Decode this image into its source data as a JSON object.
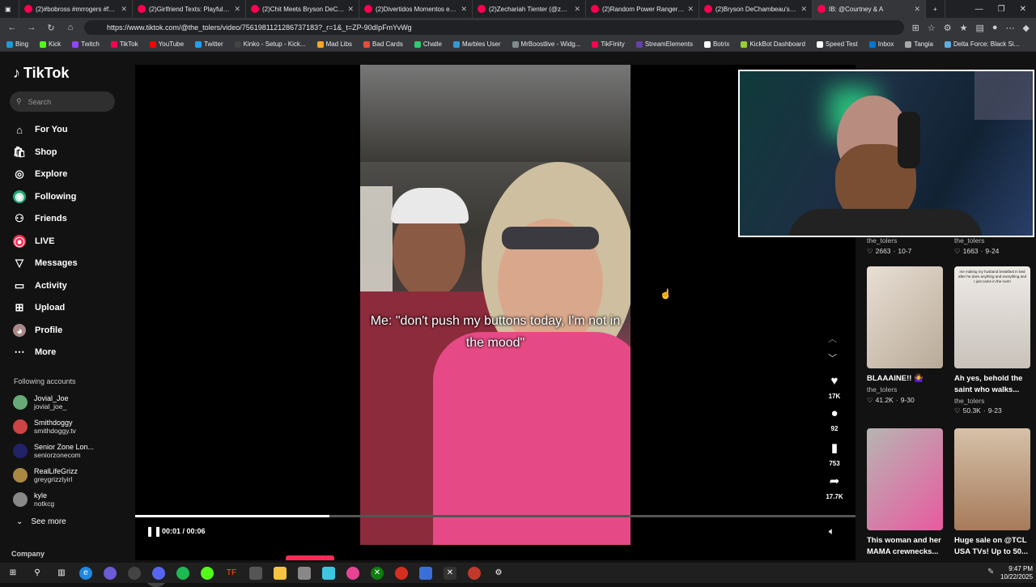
{
  "browser": {
    "tabs": [
      {
        "title": "(2)#bobross #mrrogers #faceb",
        "active": false
      },
      {
        "title": "(2)Girlfriend Texts: Playful Resp",
        "active": false
      },
      {
        "title": "(2)Chit Meets Bryson DeCham",
        "active": false
      },
      {
        "title": "(2)Divertidos Momentos en la",
        "active": false
      },
      {
        "title": "(2)Zechariah Tienter (@zechar",
        "active": false
      },
      {
        "title": "(2)Random Power Rangers Mo",
        "active": false
      },
      {
        "title": "(2)Bryson DeChambeau's Une",
        "active": false
      },
      {
        "title": "IB: @Courtney & A",
        "active": true
      }
    ],
    "url": "https://www.tiktok.com/@the_tolers/video/7561981121286737183?_r=1&_t=ZP-90dIpFmYvWg",
    "bookmarks": [
      "Bing",
      "Kick",
      "Twitch",
      "TikTok",
      "YouTube",
      "Twitter",
      "Kinko - Setup - Kick...",
      "Mad Libs",
      "Bad Cards",
      "Chatle",
      "Marbles User",
      "MrBoostlive - Widg...",
      "TikFinity",
      "StreamElements",
      "Botrix",
      "KickBot Dashboard",
      "Speed Test",
      "Inbox",
      "Tangia",
      "Delta Force: Black Si..."
    ]
  },
  "sidebar": {
    "logo": "TikTok",
    "search_placeholder": "Search",
    "nav": [
      {
        "label": "For You",
        "icon": "home-icon"
      },
      {
        "label": "Shop",
        "icon": "shop-icon"
      },
      {
        "label": "Explore",
        "icon": "compass-icon"
      },
      {
        "label": "Following",
        "icon": "following-icon"
      },
      {
        "label": "Friends",
        "icon": "friends-icon"
      },
      {
        "label": "LIVE",
        "icon": "live-icon"
      },
      {
        "label": "Messages",
        "icon": "messages-icon"
      },
      {
        "label": "Activity",
        "icon": "activity-icon"
      },
      {
        "label": "Upload",
        "icon": "upload-icon"
      },
      {
        "label": "Profile",
        "icon": "profile-icon"
      },
      {
        "label": "More",
        "icon": "more-icon"
      }
    ],
    "following_header": "Following accounts",
    "accounts": [
      {
        "name": "Jovial_Joe",
        "handle": "jovial_joe_"
      },
      {
        "name": "Smithdoggy",
        "handle": "smithdoggy.tv"
      },
      {
        "name": "Senior Zone Lon...",
        "handle": "seniorzonecom"
      },
      {
        "name": "RealLifeGrizz",
        "handle": "greygrizzlyirl"
      },
      {
        "name": "kyle",
        "handle": "notkcg"
      }
    ],
    "see_more": "See more",
    "company": "Company"
  },
  "player": {
    "caption": "Me: \"don't push my buttons today, I'm not in the mood\"",
    "time": "00:01 / 00:06",
    "progress": 0.27,
    "author": "the_tolers"
  },
  "actions": {
    "likes": "17K",
    "comments": "92",
    "saves": "753",
    "shares": "17.7K"
  },
  "grid": {
    "top_row": [
      {
        "user": "the_tolers",
        "likes": "2663",
        "date": "10-7"
      },
      {
        "user": "the_tolers",
        "likes": "1663",
        "date": "9-24"
      }
    ],
    "videos": [
      {
        "title": "BLAAAINE!! 🤷‍♀️",
        "user": "the_tolers",
        "likes": "41.2K",
        "date": "9-30",
        "thumb_text": ""
      },
      {
        "title": "Ah yes, behold the saint who walks...",
        "user": "the_tolers",
        "likes": "50.3K",
        "date": "9-23",
        "thumb_text": "me making my husband breakfast in bed after he does anything and everything and I just came in the room"
      },
      {
        "title": "This woman and her MAMA crewnecks...",
        "user": "",
        "likes": "",
        "date": "",
        "thumb_text": ""
      },
      {
        "title": "Huge sale on @TCL USA TVs! Up to 50...",
        "user": "",
        "likes": "",
        "date": "",
        "thumb_text": ""
      }
    ]
  },
  "taskbar": {
    "time": "9:47 PM",
    "date": "10/22/2025"
  }
}
